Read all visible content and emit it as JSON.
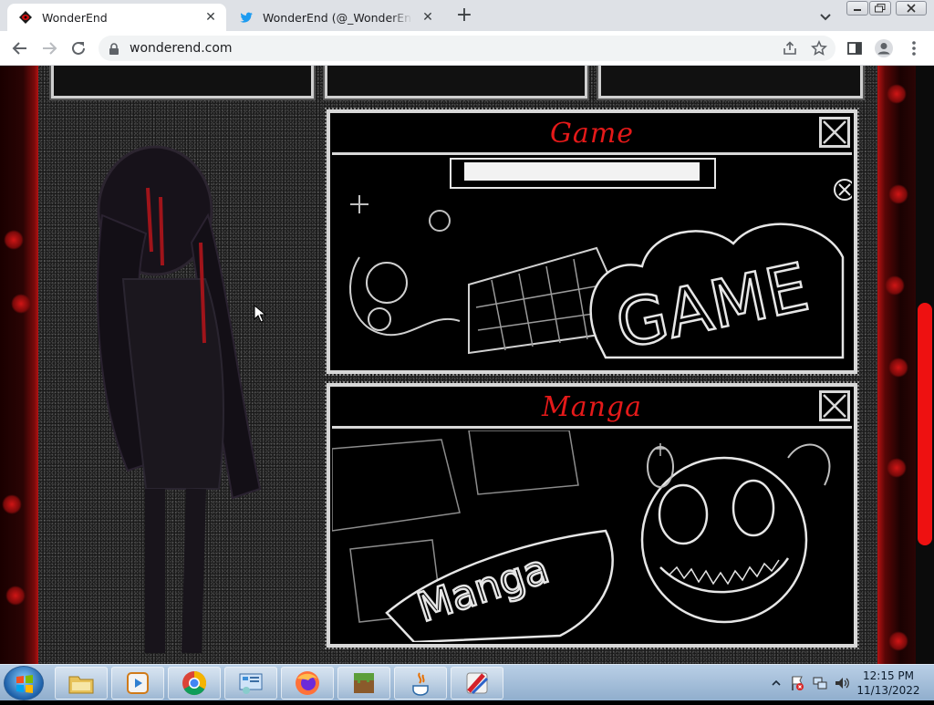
{
  "browser": {
    "tabs": [
      {
        "title": "WonderEnd",
        "active": true,
        "favicon": "wonderend-eye-icon"
      },
      {
        "title": "WonderEnd (@_WonderEnd) / Tw",
        "active": false,
        "favicon": "twitter-bird-icon"
      }
    ],
    "new_tab_label": "+",
    "url": "wonderend.com",
    "icons": [
      "back-arrow-icon",
      "forward-arrow-icon",
      "reload-icon",
      "lock-icon",
      "share-icon",
      "star-icon",
      "sidebar-icon",
      "profile-icon",
      "kebab-menu-icon"
    ]
  },
  "page": {
    "cards": [
      {
        "label": "Game",
        "art_word": "GAME"
      },
      {
        "label": "Manga",
        "art_word": "Manga"
      }
    ],
    "colors": {
      "accent_red": "#e41919",
      "scrollbar_red": "#ee1111",
      "background": "#0a0a0a"
    }
  },
  "taskbar": {
    "apps": [
      "file-explorer-icon",
      "media-player-icon",
      "chrome-icon",
      "control-panel-icon",
      "firefox-icon",
      "minecraft-icon",
      "java-icon",
      "paint-icon"
    ],
    "time": "12:15 PM",
    "date": "11/13/2022"
  }
}
